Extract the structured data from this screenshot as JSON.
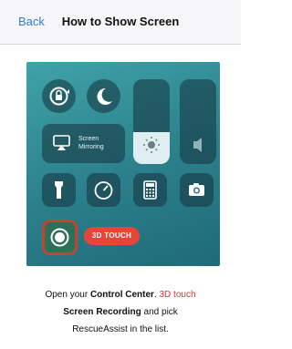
{
  "navbar": {
    "back_label": "Back",
    "title": "How to Show Screen"
  },
  "control_center": {
    "screen_mirroring_line1": "Screen",
    "screen_mirroring_line2": "Mirroring",
    "brightness_level": 0.38,
    "volume_level": 0.0
  },
  "badge_label": "3D TOUCH",
  "instructions": {
    "part1": "Open your ",
    "control_center": "Control Center",
    "part2": ". ",
    "touch": "3D touch",
    "screen_recording": "Screen Recording",
    "part3": " and pick",
    "line3": "RescueAssist in the list."
  },
  "colors": {
    "accent": "#2f7ae5",
    "highlight": "#e0322a",
    "panel": "#2b7f8b"
  }
}
